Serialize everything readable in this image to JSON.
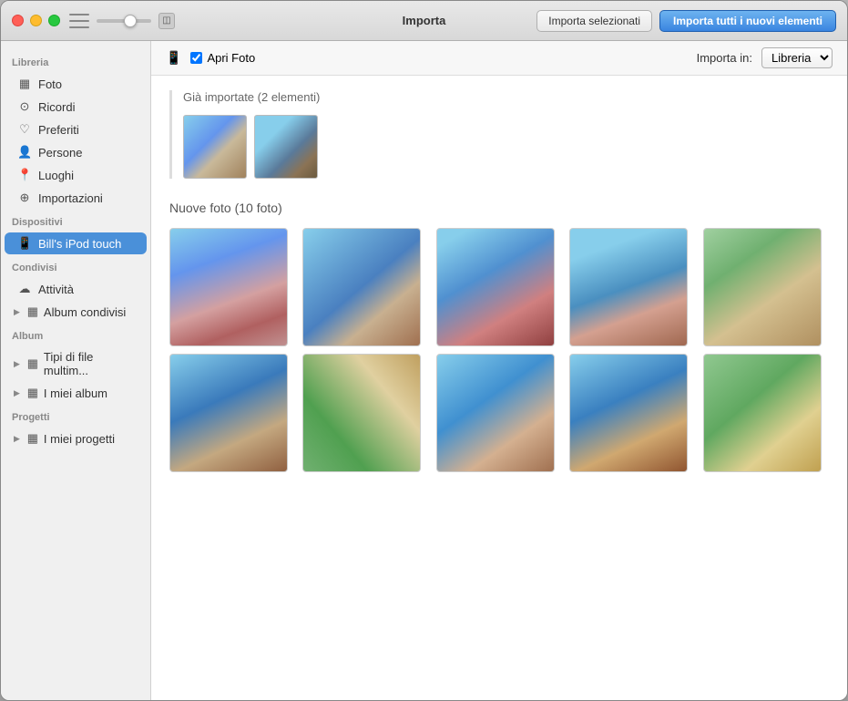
{
  "window": {
    "title": "Importa"
  },
  "titlebar": {
    "title": "Importa",
    "btn_import_selected": "Importa selezionati",
    "btn_import_all": "Importa tutti i nuovi elementi"
  },
  "device_bar": {
    "device_name": "Apri Foto",
    "import_in_label": "Importa in:",
    "import_in_value": "Libreria",
    "checkbox_checked": true
  },
  "sidebar": {
    "libreria_label": "Libreria",
    "items_libreria": [
      {
        "id": "foto",
        "icon": "▦",
        "label": "Foto"
      },
      {
        "id": "ricordi",
        "icon": "⊙",
        "label": "Ricordi"
      },
      {
        "id": "preferiti",
        "icon": "♡",
        "label": "Preferiti"
      },
      {
        "id": "persone",
        "icon": "👤",
        "label": "Persone"
      },
      {
        "id": "luoghi",
        "icon": "📍",
        "label": "Luoghi"
      },
      {
        "id": "importazioni",
        "icon": "⊕",
        "label": "Importazioni"
      }
    ],
    "dispositivi_label": "Dispositivi",
    "items_dispositivi": [
      {
        "id": "bills-ipod",
        "icon": "📱",
        "label": "Bill's iPod touch",
        "active": true
      }
    ],
    "condivisi_label": "Condivisi",
    "items_condivisi": [
      {
        "id": "attivita",
        "icon": "☁",
        "label": "Attività"
      },
      {
        "id": "album-condivisi",
        "icon": "▦",
        "label": "Album condivisi",
        "group": true
      }
    ],
    "album_label": "Album",
    "items_album": [
      {
        "id": "tipi-file",
        "icon": "▦",
        "label": "Tipi di file multim...",
        "group": true
      },
      {
        "id": "miei-album",
        "icon": "▦",
        "label": "I miei album",
        "group": true
      }
    ],
    "progetti_label": "Progetti",
    "items_progetti": [
      {
        "id": "miei-progetti",
        "icon": "▦",
        "label": "I miei progetti",
        "group": true
      }
    ]
  },
  "already_imported": {
    "title": "Già importate (2 elementi)"
  },
  "new_photos": {
    "title": "Nuove foto (10 foto)"
  }
}
